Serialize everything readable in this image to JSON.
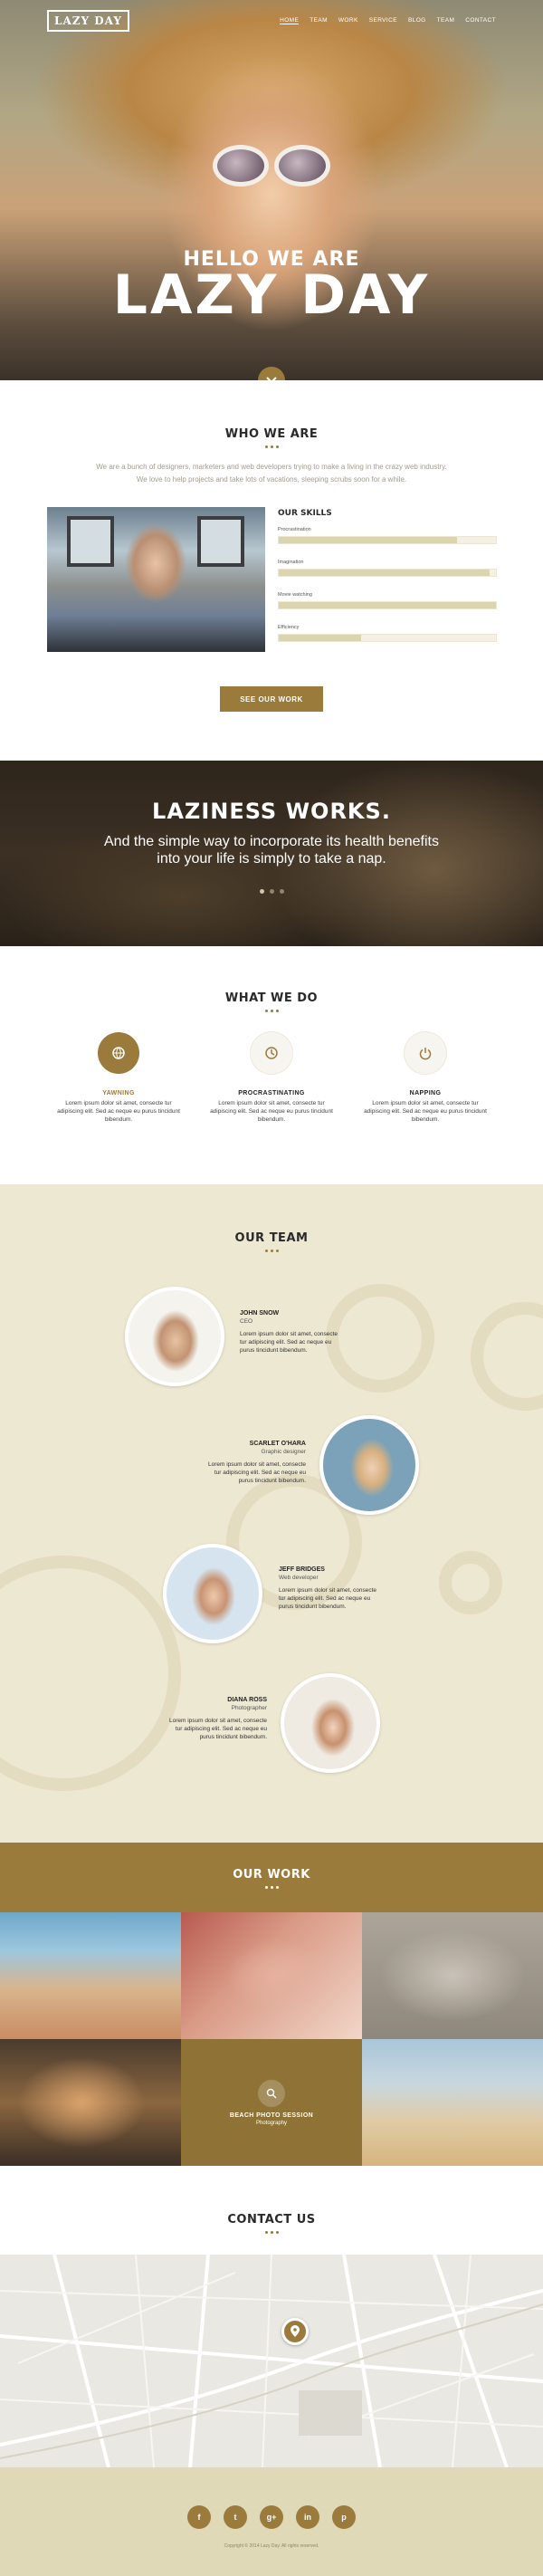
{
  "nav": {
    "logo": "LAZY DAY",
    "items": [
      "HOME",
      "TEAM",
      "WORK",
      "SERVICE",
      "BLOG",
      "TEAM",
      "CONTACT"
    ]
  },
  "hero": {
    "line1": "HELLO WE ARE",
    "line2": "LAZY DAY"
  },
  "who": {
    "title": "WHO WE ARE",
    "intro1": "We are a bunch of designers, marketers and web developers trying to make a living in the crazy web industry.",
    "intro2": "We love to help projects and take lots of vacations, sleeping scrubs soon for a while.",
    "skills_title": "OUR SKILLS",
    "skills": [
      {
        "label": "Procrastination",
        "value": 82
      },
      {
        "label": "Imagination",
        "value": 97
      },
      {
        "label": "Movie watching",
        "value": 100
      },
      {
        "label": "Efficiency",
        "value": 38
      }
    ],
    "button": "SEE OUR WORK"
  },
  "laziness": {
    "title": "LAZINESS WORKS.",
    "line1": "And the simple way to incorporate its health benefits",
    "line2": "into your life is simply to take a nap."
  },
  "what": {
    "title": "WHAT WE DO",
    "items": [
      {
        "title": "YAWNING",
        "desc": "Lorem ipsum dolor sit amet, consecte tur adipiscing elit. Sed ac neque eu purus tincidunt bibendum.",
        "icon": "ball-icon"
      },
      {
        "title": "PROCRASTINATING",
        "desc": "Lorem ipsum dolor sit amet, consecte tur adipiscing elit. Sed ac neque eu purus tincidunt bibendum.",
        "icon": "clock-icon"
      },
      {
        "title": "NAPPING",
        "desc": "Lorem ipsum dolor sit amet, consecte tur adipiscing elit. Sed ac neque eu purus tincidunt bibendum.",
        "icon": "power-icon"
      }
    ]
  },
  "team": {
    "title": "OUR TEAM",
    "members": [
      {
        "name": "JOHN SNOW",
        "role": "CEO",
        "bio": "Lorem ipsum dolor sit amet, consecte tur adipiscing elit. Sed ac neque eu purus tincidunt bibendum."
      },
      {
        "name": "SCARLET O'HARA",
        "role": "Graphic designer",
        "bio": "Lorem ipsum dolor sit amet, consecte tur adipiscing elit. Sed ac neque eu purus tincidunt bibendum."
      },
      {
        "name": "JEFF BRIDGES",
        "role": "Web developer",
        "bio": "Lorem ipsum dolor sit amet, consecte tur adipiscing elit. Sed ac neque eu purus tincidunt bibendum."
      },
      {
        "name": "DIANA ROSS",
        "role": "Photographer",
        "bio": "Lorem ipsum dolor sit amet, consecte tur adipiscing elit. Sed ac neque eu purus tincidunt bibendum."
      }
    ]
  },
  "work": {
    "title": "OUR WORK",
    "featured_title": "BEACH PHOTO SESSION",
    "featured_sub": "Photography"
  },
  "contact": {
    "title": "CONTACT US"
  },
  "footer": {
    "social": [
      "f",
      "t",
      "g+",
      "in",
      "p"
    ],
    "copyright": "Copyright © 2014 Lazy Day. All rights reserved."
  },
  "colors": {
    "accent": "#9a7b3b",
    "team_bg": "#ede8d2",
    "footer_bg": "#dfd9b8"
  }
}
